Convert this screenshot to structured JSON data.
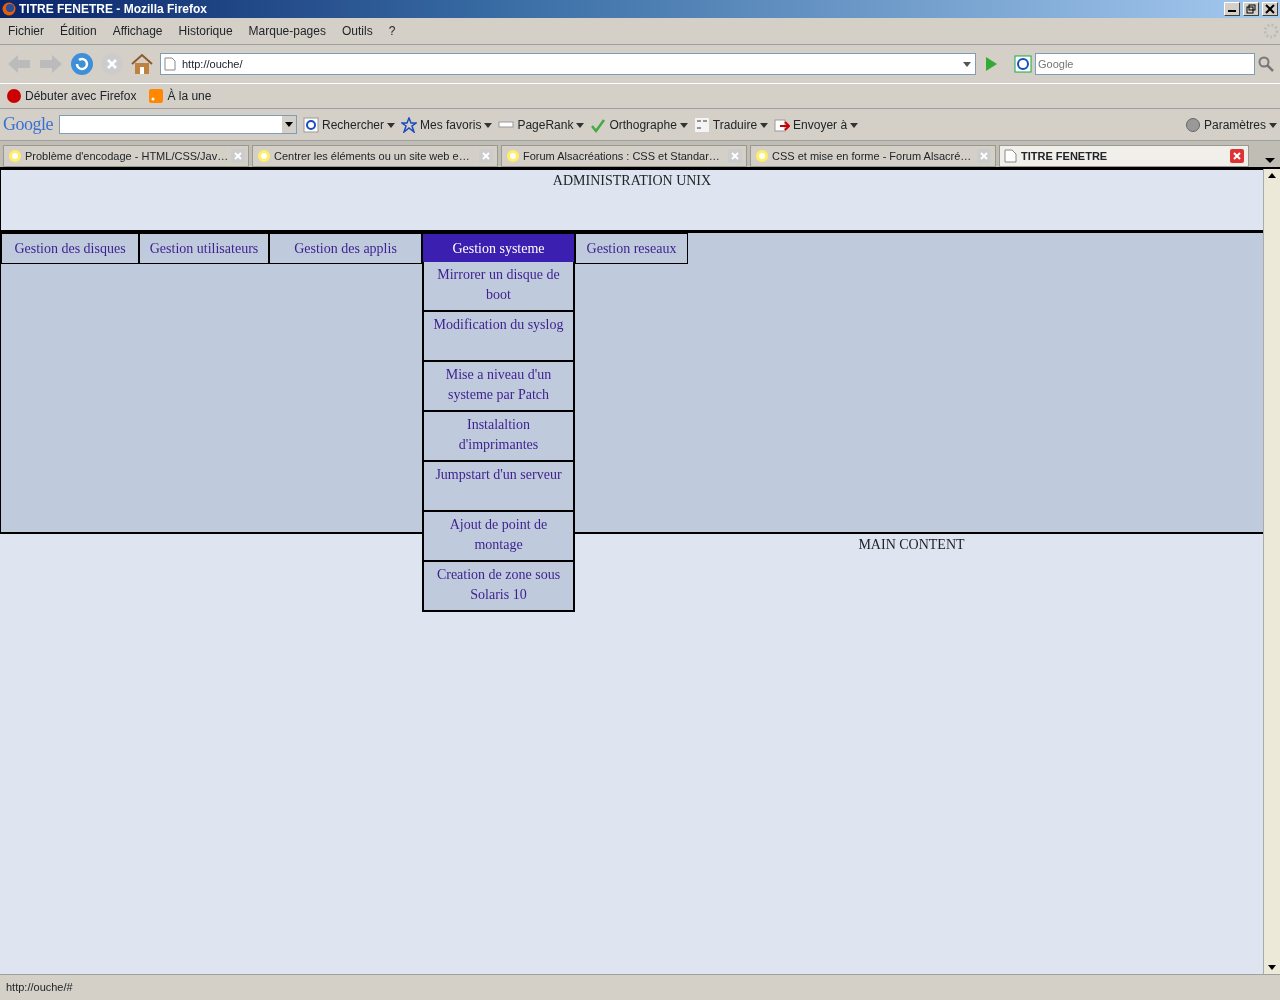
{
  "window": {
    "title": "TITRE FENETRE - Mozilla Firefox"
  },
  "menu_bar": [
    "Fichier",
    "Édition",
    "Affichage",
    "Historique",
    "Marque-pages",
    "Outils",
    "?"
  ],
  "nav_toolbar": {
    "url": "http://ouche/",
    "search_placeholder": "Google"
  },
  "bookmarks": [
    "Débuter avec Firefox",
    "À la une"
  ],
  "google_toolbar": {
    "logo": "Google",
    "buttons": [
      "Rechercher",
      "Mes favoris",
      "PageRank",
      "Orthographe",
      "Traduire",
      "Envoyer à",
      "Paramètres"
    ]
  },
  "tabs": [
    {
      "label": "Problème d'encodage - HTML/CSS/Jav…",
      "selected": false
    },
    {
      "label": "Centrer les éléments ou un site web e…",
      "selected": false
    },
    {
      "label": "Forum Alsacréations : CSS et Standar…",
      "selected": false
    },
    {
      "label": "CSS et mise en forme - Forum Alsacré…",
      "selected": false
    },
    {
      "label": "TITRE FENETRE",
      "selected": true
    }
  ],
  "page": {
    "header_title": "ADMINISTRATION UNIX",
    "nav_items": [
      {
        "label": "Gestion des disques",
        "selected": false
      },
      {
        "label": "Gestion utilisateurs",
        "selected": false
      },
      {
        "label": "Gestion des applis",
        "selected": false
      },
      {
        "label": "Gestion systeme",
        "selected": true,
        "submenu": [
          "Mirrorer un disque de boot",
          "Modification du syslog",
          "Mise a niveau d'un systeme par Patch",
          "Instalaltion d'imprimantes",
          "Jumpstart d'un serveur",
          "Ajout de point de montage",
          "Creation de zone sous Solaris 10"
        ]
      },
      {
        "label": "Gestion reseaux",
        "selected": false
      }
    ],
    "main_title": "MAIN CONTENT"
  },
  "status_bar": "http://ouche/#"
}
